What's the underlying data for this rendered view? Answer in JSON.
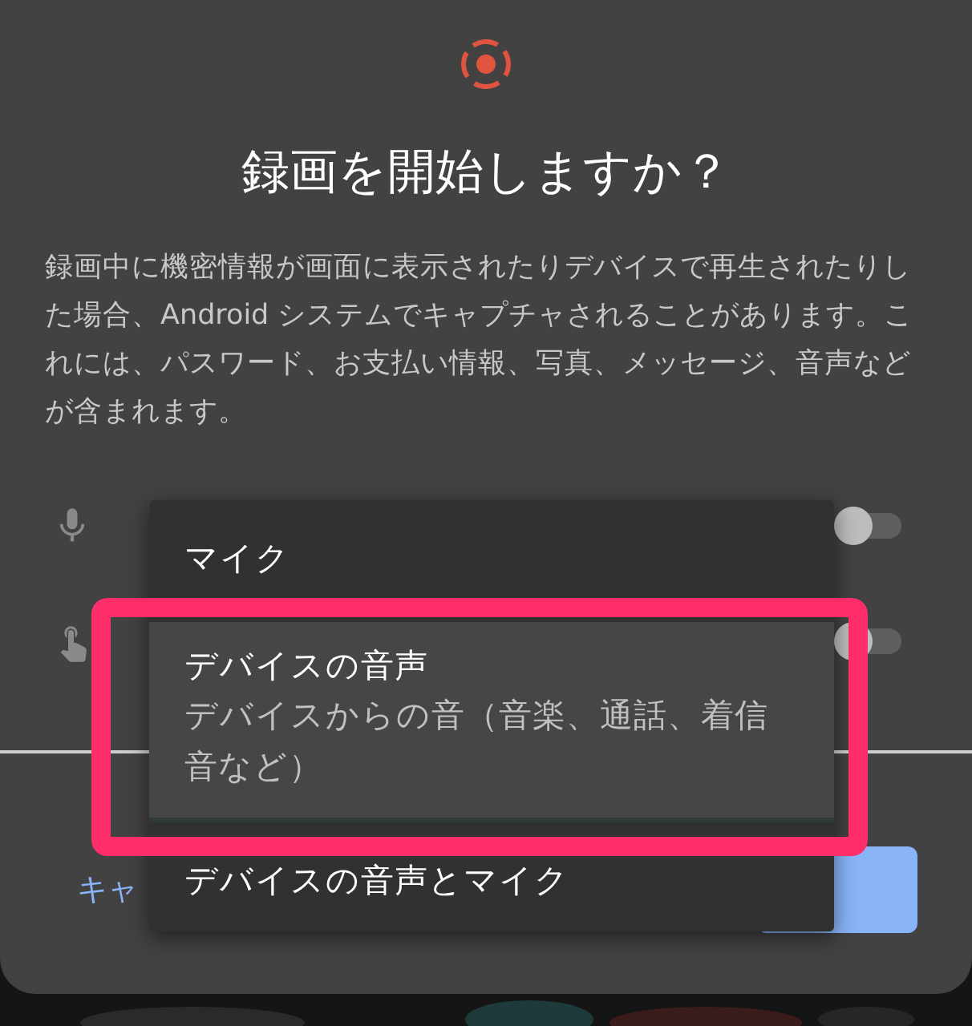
{
  "dialog": {
    "title": "録画を開始しますか？",
    "message": "録画中に機密情報が画面に表示されたりデバイスで再生されたりした場合、Android システムでキャプチャされることがあります。これには、パスワード、お支払い情報、写真、メッセージ、音声などが含まれます。",
    "options": [
      {
        "kind": "mic",
        "on": false
      },
      {
        "kind": "touch",
        "on": false
      }
    ],
    "buttons": [
      {
        "kind": "text",
        "label": "キャ"
      },
      {
        "kind": "filled"
      }
    ]
  },
  "menu": {
    "items": [
      {
        "label": "マイク",
        "selected": false
      },
      {
        "label": "デバイスの音声",
        "description": "デバイスからの音（音楽、通話、着信音など）",
        "selected": true
      },
      {
        "label": "デバイスの音声とマイク",
        "selected": false
      }
    ]
  },
  "annotation": {
    "kind": "highlight"
  }
}
